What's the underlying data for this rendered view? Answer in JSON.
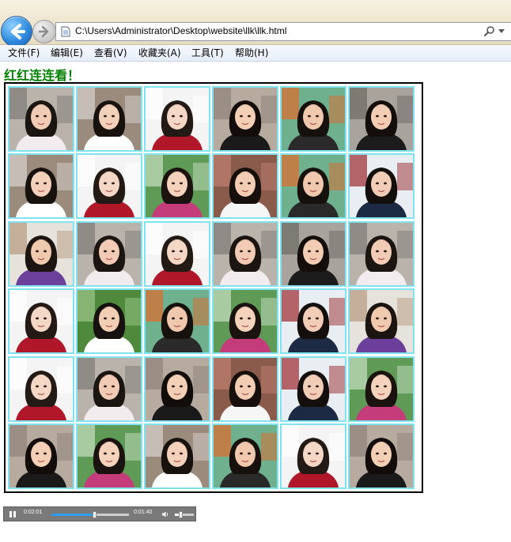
{
  "browser": {
    "address": "C:\\Users\\Administrator\\Desktop\\website\\llk\\llk.html",
    "icons": [
      "back-arrow-icon",
      "forward-arrow-icon",
      "page-file-icon",
      "search-icon",
      "dropdown-arrow-icon"
    ]
  },
  "menu": {
    "items": [
      "文件(F)",
      "编辑(E)",
      "查看(V)",
      "收藏夹(A)",
      "工具(T)",
      "帮助(H)"
    ]
  },
  "page": {
    "title": "红红连连看！"
  },
  "board": {
    "rows": 6,
    "cols": 6,
    "tile_border_color": "#7fe4ef",
    "tiles": [
      [
        "P1",
        "P2",
        "P3",
        "P4",
        "P5",
        "P6"
      ],
      [
        "P2",
        "P3",
        "P7",
        "P8",
        "P5",
        "P9"
      ],
      [
        "P10",
        "P1",
        "P3",
        "P1",
        "P6",
        "P1"
      ],
      [
        "P3",
        "P11",
        "P5",
        "P7",
        "P9",
        "P10"
      ],
      [
        "P3",
        "P1",
        "P4",
        "P8",
        "P9",
        "P7"
      ],
      [
        "P4",
        "P7",
        "P2",
        "P5",
        "P3",
        "P4"
      ]
    ],
    "photo_styles": {
      "P1": {
        "bg": "#b9b3ab",
        "accent": "#7d7a76",
        "shirt": "#f2ecee",
        "hair": "#1b1512",
        "skin": "#f1cbb4"
      },
      "P2": {
        "bg": "#9a8b7c",
        "accent": "#d9d4cf",
        "shirt": "#ffffff",
        "hair": "#18120f",
        "skin": "#f3d0ba"
      },
      "P3": {
        "bg": "#f4f4f4",
        "accent": "#ffffff",
        "shirt": "#b0182a",
        "hair": "#231a16",
        "skin": "#f5d7c6"
      },
      "P4": {
        "bg": "#b7aba0",
        "accent": "#8e8278",
        "shirt": "#1a1a1a",
        "hair": "#120d0a",
        "skin": "#f3cfb5"
      },
      "P5": {
        "bg": "#6fb18e",
        "accent": "#e06a2c",
        "shirt": "#2a2a2a",
        "hair": "#17110e",
        "skin": "#f0c8ad"
      },
      "P6": {
        "bg": "#a9a39d",
        "accent": "#6c6863",
        "shirt": "#1c1c1c",
        "hair": "#130e0b",
        "skin": "#f2cdb3"
      },
      "P7": {
        "bg": "#5f9b56",
        "accent": "#c9e0c3",
        "shirt": "#c43c7a",
        "hair": "#1a130f",
        "skin": "#f4d2bb"
      },
      "P8": {
        "bg": "#8a5a4a",
        "accent": "#c08070",
        "shirt": "#f6f6f6",
        "hair": "#160f0c",
        "skin": "#f2ccb3"
      },
      "P9": {
        "bg": "#e9eef2",
        "accent": "#9a2a2e",
        "shirt": "#1d2a44",
        "hair": "#140f0c",
        "skin": "#f1cdb7"
      },
      "P10": {
        "bg": "#e6e2dc",
        "accent": "#b49a7e",
        "shirt": "#6b3f9a",
        "hair": "#1b1411",
        "skin": "#f0caae"
      },
      "P11": {
        "bg": "#4f8a3c",
        "accent": "#9ec78a",
        "shirt": "#ffffff",
        "hair": "#171210",
        "skin": "#f2ceb5"
      }
    }
  },
  "player": {
    "elapsed": "0:02:01",
    "total": "0:01:40",
    "progress": 0.55,
    "volume": 0.3,
    "icons": [
      "pause-icon",
      "volume-icon"
    ]
  }
}
